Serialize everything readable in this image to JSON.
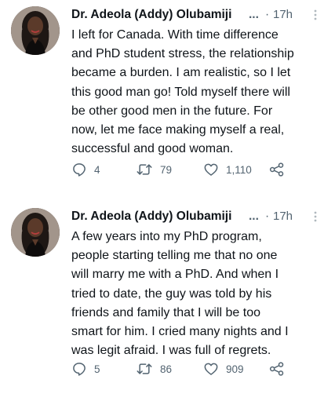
{
  "tweets": [
    {
      "author_name": "Dr. Adeola (Addy) Olubamiji",
      "name_ellipsis": "...",
      "separator": "·",
      "time": "17h",
      "text_lines": [
        "I left for Canada. With time difference",
        "and PhD student stress, the relationship",
        "became a burden. I am realistic, so I let",
        "this good man go! Told myself there will",
        "be other good men in the future. For",
        "now, let me face making myself a real,",
        "successful and good woman."
      ],
      "replies": "4",
      "retweets": "79",
      "likes": "1,110"
    },
    {
      "author_name": "Dr. Adeola (Addy) Olubamiji",
      "name_ellipsis": "...",
      "separator": "·",
      "time": "17h",
      "text_lines": [
        "A few years into my PhD program,",
        "people starting telling me that no one",
        "will marry me with a PhD. And when I",
        "tried to date, the guy was told by his",
        "friends and family that I will be too",
        "smart for him. I cried many nights and I",
        "was legit afraid. I was full of regrets."
      ],
      "replies": "5",
      "retweets": "86",
      "likes": "909"
    }
  ],
  "colors": {
    "text": "#0f1419",
    "muted": "#536471",
    "icon": "#536471"
  },
  "icons": {
    "avatar": "profile-photo",
    "more": "more-options-icon",
    "reply": "reply-icon",
    "retweet": "retweet-icon",
    "like": "like-icon",
    "share": "share-icon"
  }
}
